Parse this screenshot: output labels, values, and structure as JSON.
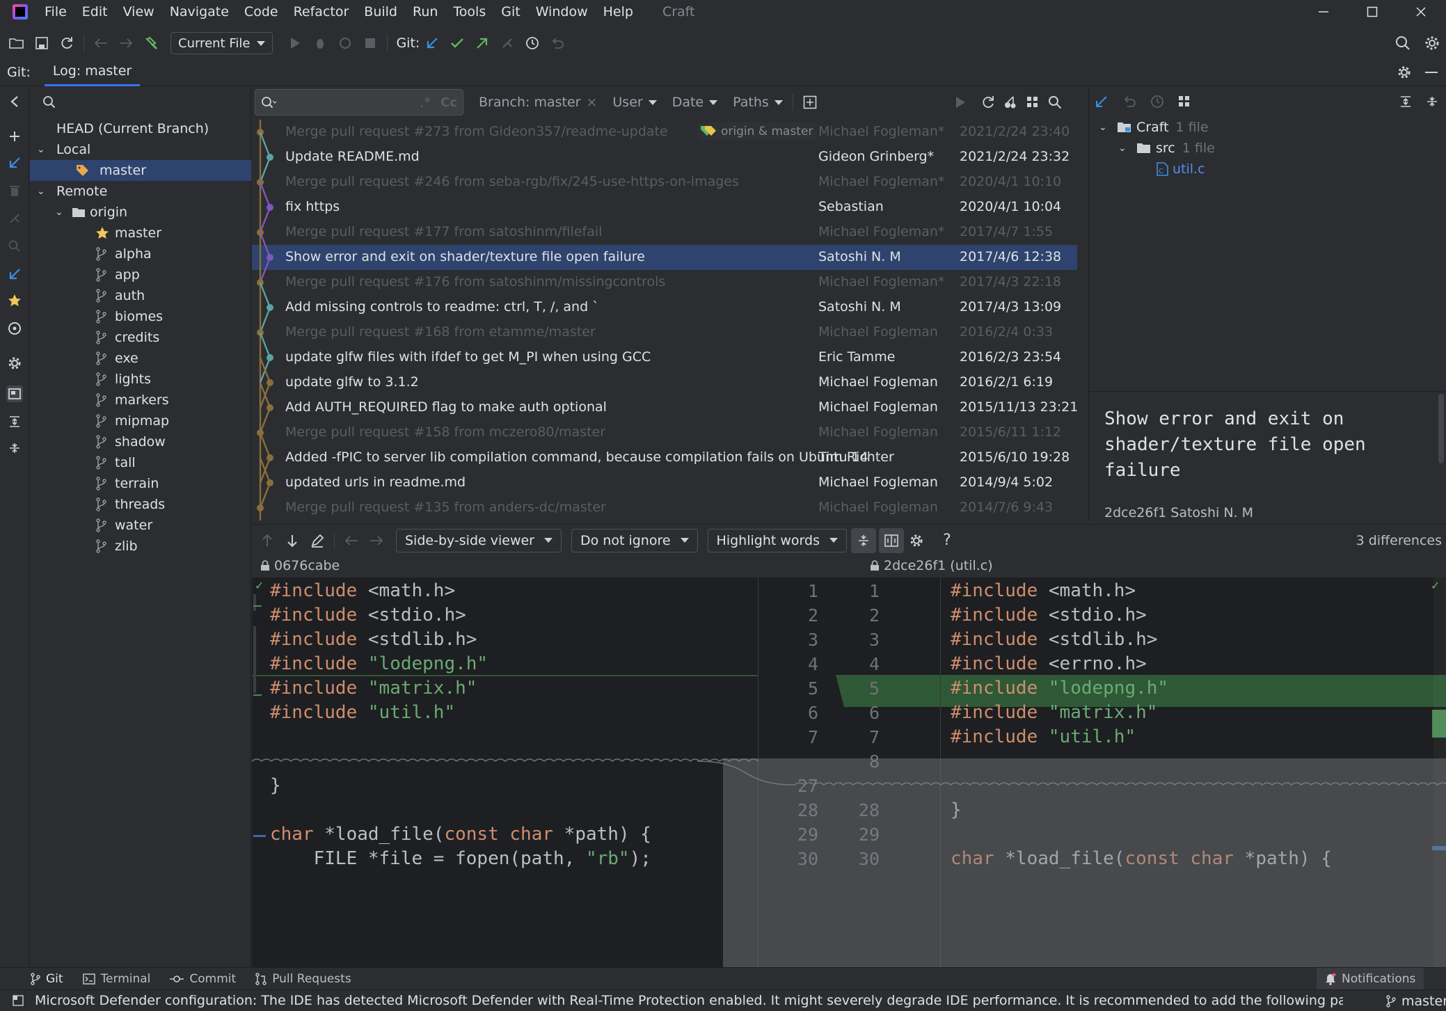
{
  "menubar": {
    "items": [
      "File",
      "Edit",
      "View",
      "Navigate",
      "Code",
      "Refactor",
      "Build",
      "Run",
      "Tools",
      "Git",
      "Window",
      "Help"
    ],
    "project": "Craft"
  },
  "toolbar": {
    "run_config": "Current File",
    "git_label": "Git:"
  },
  "tool_window": {
    "label": "Git:",
    "tab": "Log: master"
  },
  "branches": {
    "head": "HEAD (Current Branch)",
    "local_label": "Local",
    "local": [
      "master"
    ],
    "remote_label": "Remote",
    "origin_label": "origin",
    "origin": [
      "master",
      "alpha",
      "app",
      "auth",
      "biomes",
      "credits",
      "exe",
      "lights",
      "markers",
      "mipmap",
      "shadow",
      "tall",
      "terrain",
      "threads",
      "water",
      "zlib"
    ]
  },
  "log_filters": {
    "branch": "Branch: master",
    "user": "User",
    "date": "Date",
    "paths": "Paths",
    "cc": "Cc"
  },
  "commits": [
    {
      "msg": "Merge pull request #273 from Gideon357/readme-update",
      "author": "Michael Fogleman*",
      "date": "2021/2/24 23:40",
      "dim": true,
      "tag": "origin & master"
    },
    {
      "msg": "Update README.md",
      "author": "Gideon Grinberg*",
      "date": "2021/2/24 23:32",
      "dim": false
    },
    {
      "msg": "Merge pull request #246 from seba-rgb/fix/245-use-https-on-images",
      "author": "Michael Fogleman*",
      "date": "2020/4/1 10:10",
      "dim": true
    },
    {
      "msg": "fix https",
      "author": "Sebastian",
      "date": "2020/4/1 10:04",
      "dim": false
    },
    {
      "msg": "Merge pull request #177 from satoshinm/filefail",
      "author": "Michael Fogleman*",
      "date": "2017/4/7 1:55",
      "dim": true
    },
    {
      "msg": "Show error and exit on shader/texture file open failure",
      "author": "Satoshi N. M",
      "date": "2017/4/6 12:38",
      "dim": false,
      "selected": true
    },
    {
      "msg": "Merge pull request #176 from satoshinm/missingcontrols",
      "author": "Michael Fogleman*",
      "date": "2017/4/3 22:18",
      "dim": true
    },
    {
      "msg": "Add missing controls to readme: ctrl, T, /, and `",
      "author": "Satoshi N. M",
      "date": "2017/4/3 13:09",
      "dim": false
    },
    {
      "msg": "Merge pull request #168 from etamme/master",
      "author": "Michael Fogleman",
      "date": "2016/2/4 0:33",
      "dim": true
    },
    {
      "msg": "update glfw files with ifdef to get M_PI when using GCC",
      "author": "Eric Tamme",
      "date": "2016/2/3 23:54",
      "dim": false
    },
    {
      "msg": "update glfw to 3.1.2",
      "author": "Michael Fogleman",
      "date": "2016/2/1 6:19",
      "dim": false
    },
    {
      "msg": "Add AUTH_REQUIRED flag to make auth optional",
      "author": "Michael Fogleman",
      "date": "2015/11/13 23:21",
      "dim": false
    },
    {
      "msg": "Merge pull request #158 from mczero80/master",
      "author": "Michael Fogleman",
      "date": "2015/6/11 1:12",
      "dim": true
    },
    {
      "msg": "Added -fPIC to server lib compilation command, because compilation fails on Ubuntu 14",
      "author": "Tim Richter",
      "date": "2015/6/10 19:28",
      "dim": false
    },
    {
      "msg": "updated urls in readme.md",
      "author": "Michael Fogleman",
      "date": "2014/9/4 5:02",
      "dim": false
    },
    {
      "msg": "Merge pull request #135 from anders-dc/master",
      "author": "Michael Fogleman",
      "date": "2014/7/6 9:43",
      "dim": true
    }
  ],
  "changes_tree": {
    "root": "Craft",
    "root_count": "1 file",
    "dir": "src",
    "dir_count": "1 file",
    "file": "util.c"
  },
  "commit_detail": {
    "message": "Show error and exit on shader/texture file open failure",
    "hash_author": "2dce26f1 Satoshi N. M"
  },
  "diff_toolbar": {
    "viewer": "Side-by-side viewer",
    "ignore": "Do not ignore",
    "highlight": "Highlight words",
    "help": "?",
    "differences": "3 differences"
  },
  "diff_header": {
    "left": "0676cabe",
    "right": "2dce26f1 (util.c)"
  },
  "diff": {
    "left_lines": [
      "#include <math.h>",
      "#include <stdio.h>",
      "#include <stdlib.h>",
      "#include \"lodepng.h\"",
      "#include \"matrix.h\"",
      "#include \"util.h\""
    ],
    "right_lines": [
      "#include <math.h>",
      "#include <stdio.h>",
      "#include <stdlib.h>",
      "#include <errno.h>",
      "#include \"lodepng.h\"",
      "#include \"matrix.h\"",
      "#include \"util.h\""
    ],
    "left_nums": [
      "1",
      "2",
      "3",
      "4",
      "5",
      "6",
      "7",
      "",
      "27",
      "28",
      "29",
      "30"
    ],
    "right_nums": [
      "1",
      "2",
      "3",
      "4",
      "5",
      "6",
      "7",
      "8",
      "",
      "28",
      "29",
      "30"
    ],
    "left_tail": [
      "}",
      "",
      "char *load_file(const char *path) {",
      "    FILE *file = fopen(path, \"rb\");"
    ],
    "right_tail": [
      "}",
      "",
      "char *load_file(const char *path) {"
    ]
  },
  "bottom_tabs": [
    "Git",
    "Terminal",
    "Commit",
    "Pull Requests"
  ],
  "notifications": "Notifications",
  "status": {
    "message": "Microsoft Defender configuration: The IDE has detected Microsoft Defender with Real-Time Protection enabled. It might severely degrade IDE performance. It is recommended to add the following paths ... (a minute ago)",
    "branch": "master"
  },
  "colors": {
    "accent": "#3574f0",
    "selection": "#2e436e",
    "added": "#4d8a57",
    "keyword": "#cf8e6d",
    "string": "#6aab73"
  }
}
